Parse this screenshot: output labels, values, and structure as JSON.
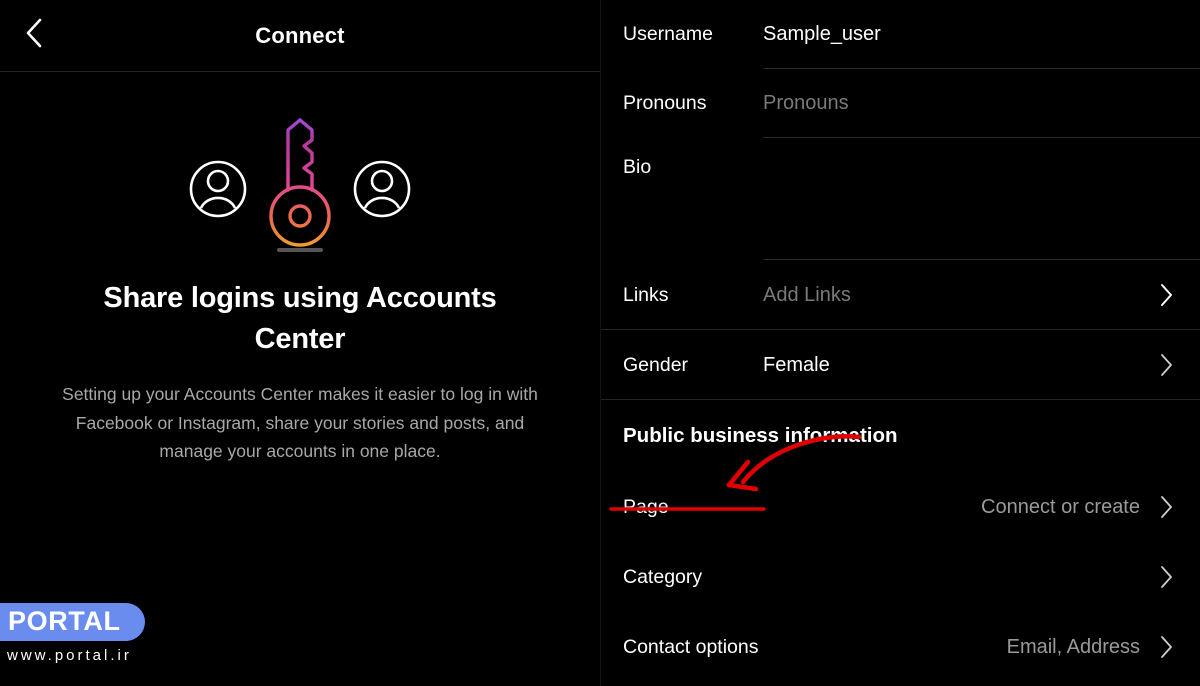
{
  "left": {
    "header": {
      "title": "Connect",
      "back_icon": "chevron-left-icon"
    },
    "illustration": {
      "key_icon": "key-icon",
      "avatar_left_icon": "person-circle-icon",
      "avatar_right_icon": "person-circle-icon",
      "gradient_top": "#9B4DE0",
      "gradient_mid": "#E0449A",
      "gradient_bottom": "#F0A030"
    },
    "headline": "Share logins using Accounts Center",
    "subtext": "Setting up your Accounts Center makes it easier to log in with Facebook or Instagram, share your stories and posts, and manage your accounts in one place."
  },
  "watermark": {
    "brand": "PORTAL",
    "url": "www.portal.ir",
    "pill_color": "#6b8cef"
  },
  "right": {
    "fields": [
      {
        "label": "Username",
        "value": "Sample_user",
        "is_placeholder": false
      },
      {
        "label": "Pronouns",
        "value": "Pronouns",
        "is_placeholder": true
      },
      {
        "label": "Bio",
        "value": "",
        "is_placeholder": false
      }
    ],
    "links_row": {
      "label": "Links",
      "value": "Add Links",
      "chevron": "chevron-right-icon"
    },
    "gender_row": {
      "label": "Gender",
      "value": "Female",
      "chevron": "chevron-right-icon"
    },
    "section_title": "Public business information",
    "business_rows": [
      {
        "label": "Page",
        "value": "Connect or create",
        "chevron": "chevron-right-icon"
      },
      {
        "label": "Category",
        "value": "",
        "chevron": "chevron-right-icon"
      },
      {
        "label": "Contact options",
        "value": "Email, Address",
        "chevron": "chevron-right-icon"
      }
    ]
  },
  "annotation": {
    "color": "#e00000",
    "arrow_icon": "curved-arrow-icon",
    "underline_icon": "underline-mark"
  }
}
